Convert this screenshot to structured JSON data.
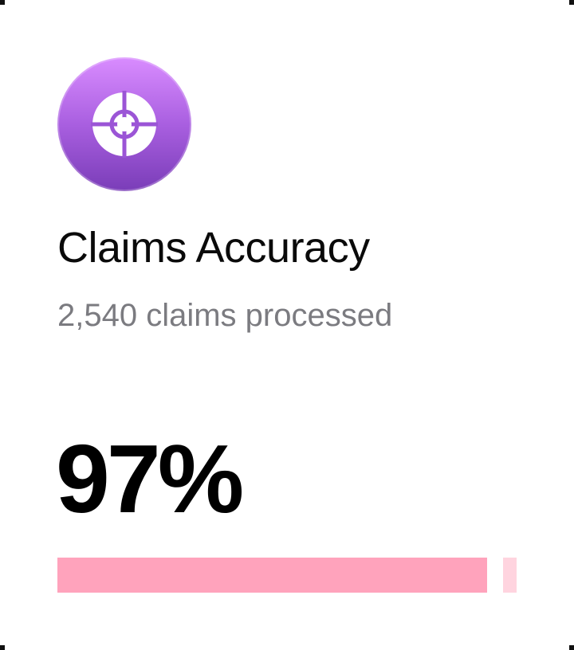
{
  "card": {
    "icon": "crosshair-icon",
    "title": "Claims Accuracy",
    "subtitle": "2,540 claims processed",
    "metric": "97%",
    "progress_fraction": 0.97
  },
  "colors": {
    "icon_gradient_top": "#d98cff",
    "icon_gradient_bottom": "#7a3db8",
    "title": "#0a0a0a",
    "subtitle": "#7b7b80",
    "progress_fill": "#ffa3bc",
    "progress_track": "#ffd4df"
  }
}
